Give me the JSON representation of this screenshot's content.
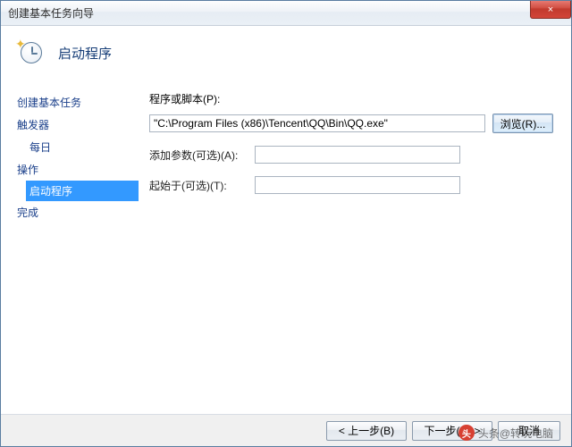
{
  "window": {
    "title": "创建基本任务向导",
    "close": "×"
  },
  "header": {
    "title": "启动程序"
  },
  "sidebar": {
    "items": [
      {
        "label": "创建基本任务"
      },
      {
        "label": "触发器"
      },
      {
        "label": "每日",
        "sub": true
      },
      {
        "label": "操作"
      },
      {
        "label": "启动程序",
        "sub": true,
        "selected": true
      },
      {
        "label": "完成"
      }
    ]
  },
  "form": {
    "program_label": "程序或脚本(P):",
    "program_value": "\"C:\\Program Files (x86)\\Tencent\\QQ\\Bin\\QQ.exe\"",
    "browse_label": "浏览(R)...",
    "args_label": "添加参数(可选)(A):",
    "args_value": "",
    "startin_label": "起始于(可选)(T):",
    "startin_value": ""
  },
  "footer": {
    "back": "< 上一步(B)",
    "next": "下一步(N) >",
    "cancel": "取消"
  },
  "watermark": {
    "text": "头条@转玩电脑"
  }
}
